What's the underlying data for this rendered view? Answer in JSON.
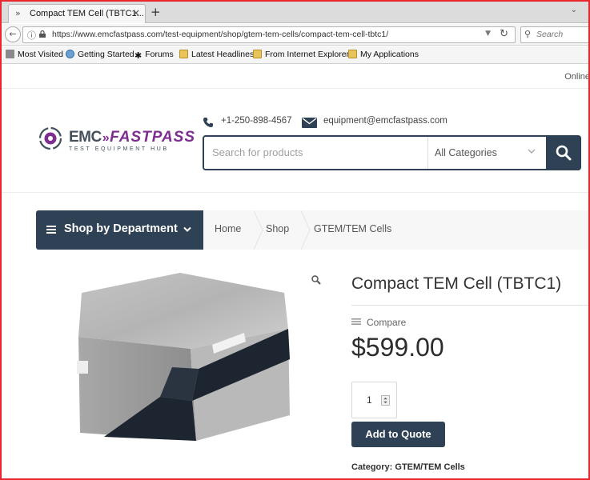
{
  "browser": {
    "tab_title": "Compact TEM Cell (TBTC1...",
    "url": "https://www.emcfastpass.com/test-equipment/shop/gtem-tem-cells/compact-tem-cell-tbtc1/",
    "search_placeholder": "Search",
    "bookmarks": [
      "Most Visited",
      "Getting Started",
      "Forums",
      "Latest Headlines",
      "From Internet Explorer",
      "My Applications"
    ]
  },
  "site": {
    "top_bar_text": "Online",
    "logo": {
      "emc": "EMC",
      "fastpass": "FASTPASS",
      "tagline": "TEST EQUIPMENT HUB"
    },
    "phone": "+1-250-898-4567",
    "email": "equipment@emcfastpass.com",
    "search_placeholder": "Search for products",
    "category_select": "All Categories",
    "department_button": "Shop by Department",
    "breadcrumbs": [
      "Home",
      "Shop",
      "GTEM/TEM Cells"
    ]
  },
  "product": {
    "title": "Compact TEM Cell (TBTC1)",
    "compare_label": "Compare",
    "price": "$599.00",
    "quantity": "1",
    "add_button": "Add to Quote",
    "category_label": "Category:",
    "category_value": "GTEM/TEM Cells"
  },
  "colors": {
    "navy": "#2f4154",
    "brand_purple": "#7d2e8f",
    "frame_red": "#e8262b"
  }
}
